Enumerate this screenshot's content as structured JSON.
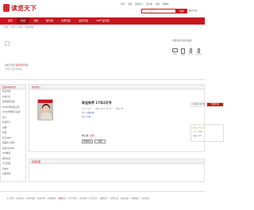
{
  "header": {
    "logo_text": "读览天下",
    "top_links": [
      "登录",
      "注册",
      "帮助中心",
      "客户端",
      "充值",
      "购物车"
    ],
    "search_placeholder": "杂志名/期刊号",
    "search_button": "搜索",
    "user_link": "我的书架"
  },
  "nav": {
    "items": [
      "首页",
      "杂志",
      "书籍",
      "数字报",
      "优惠专区",
      "会员专区",
      "VIP产品专区"
    ],
    "active_index": 1
  },
  "breadcrumb": "首页 > 杂志 > 时尚 > 珠宝饰界",
  "promo": {
    "login_text_prefix": "如您已登录,",
    "login_link": "请先登录",
    "login_text_suffix": "查看",
    "subline": "已购买,请直接阅读"
  },
  "devices": {
    "title": "免费阅读:支持的设备",
    "items": [
      "电脑",
      "iPad",
      "iPhone",
      "Android",
      "Kindle"
    ]
  },
  "sidebar": {
    "title": "更多时尚杂志",
    "items": [
      "珠宝饰界",
      "时尚芭莎",
      "瑞丽服饰美容",
      "ELLE世界时装之苑",
      "VOGUE服饰与美容",
      "嘉人",
      "时装男士",
      "米娜",
      "昕薇",
      "悦己SELF",
      "瑞丽伊人风尚",
      "时尚COSMO",
      "OK!精彩",
      "都市主妇",
      "今日风采",
      "风尚志",
      "新民周刊"
    ]
  },
  "main": {
    "section_title": "杂志简介",
    "magazine_title": "珠宝饰界 17年2月号",
    "meta_row1": [
      "刊号: 月刊",
      "出版: 2017-02-01",
      "页数: 96"
    ],
    "meta_row2_label": "期号: ",
    "meta_row2_link": "查看往期",
    "meta_row3_label": "类别: ",
    "meta_row3_link": "时尚",
    "price_label": "电子版: ",
    "price_value": "免费",
    "buttons": [
      "免费阅读",
      "收藏"
    ]
  },
  "right_box": {
    "left": "订阅杂志电子版",
    "right": "免费订阅"
  },
  "rating": {
    "label": "评分:",
    "stars": "★★★★☆",
    "row2": "人气: 2389",
    "row3": "收藏: 126"
  },
  "notice": {
    "title": "往期回顾"
  },
  "footer": {
    "links": [
      "关于我们",
      "联系我们",
      "网站地图",
      "版权声明",
      "投稿须知",
      "客服中心",
      "新手指南",
      "常见问题",
      "合作伙伴",
      "诚聘英才",
      "意见反馈",
      "隐私政策",
      "网络备案",
      "营业执照"
    ],
    "highlight_index": 5
  },
  "colors": {
    "brand": "#c8161d",
    "link": "#2a5caa"
  }
}
